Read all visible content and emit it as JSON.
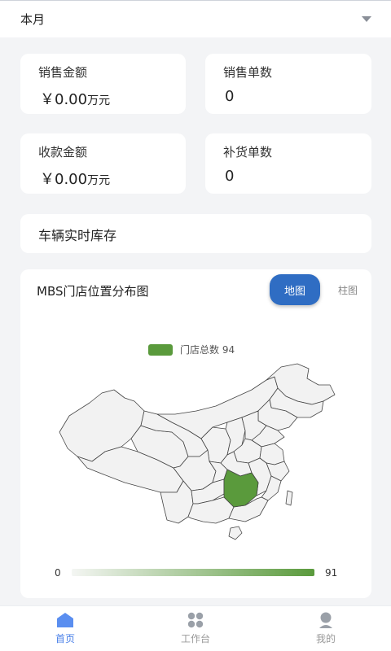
{
  "period": {
    "label": "本月"
  },
  "stats": [
    {
      "title": "销售金额",
      "value": "￥0.00",
      "unit": "万元"
    },
    {
      "title": "销售单数",
      "value": "0",
      "unit": ""
    },
    {
      "title": "收款金额",
      "value": "￥0.00",
      "unit": "万元"
    },
    {
      "title": "补货单数",
      "value": "0",
      "unit": ""
    }
  ],
  "inventory": {
    "title": "车辆实时库存"
  },
  "map_panel": {
    "title": "MBS门店位置分布图",
    "toggle_map": "地图",
    "toggle_bar": "柱图",
    "legend": "门店总数 94",
    "range_min": "0",
    "range_max": "91",
    "colors": {
      "highlight": "#5a9a3c",
      "region": "#f2f2f2",
      "border": "#444444"
    },
    "highlighted_region_value": 91
  },
  "tabbar": {
    "items": [
      {
        "label": "首页",
        "icon": "home-icon",
        "active": true
      },
      {
        "label": "工作台",
        "icon": "grid-icon",
        "active": false
      },
      {
        "label": "我的",
        "icon": "user-icon",
        "active": false
      }
    ]
  }
}
